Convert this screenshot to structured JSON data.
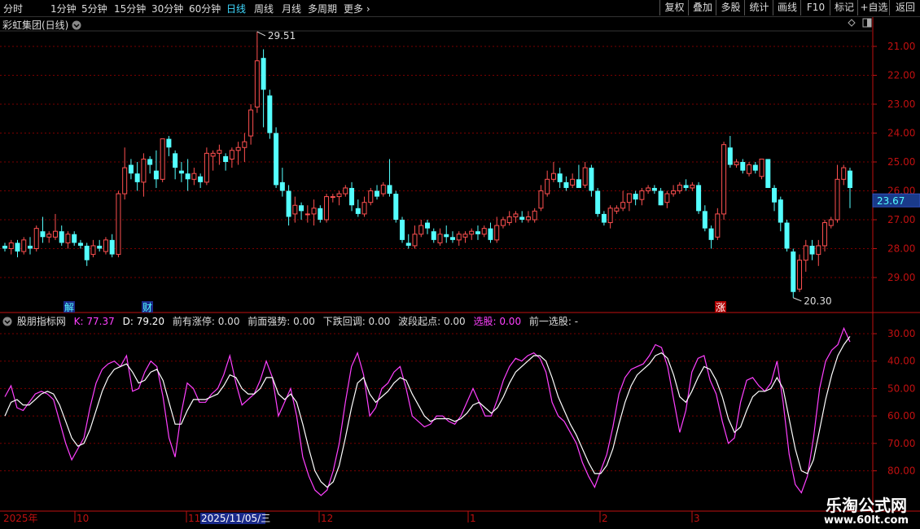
{
  "toolbar": {
    "periods": [
      "分时",
      "1分钟",
      "5分钟",
      "15分钟",
      "30分钟",
      "60分钟",
      "日线",
      "周线",
      "月线",
      "多周期",
      "更多"
    ],
    "active_period": "日线",
    "buttons": [
      "复权",
      "叠加",
      "多股",
      "统计",
      "画线",
      "F10",
      "标记",
      "+自选",
      "返回"
    ]
  },
  "stock": {
    "name": "彩虹集团(日线)"
  },
  "price_panel": {
    "y_ticks": [
      "29.00",
      "28.00",
      "27.00",
      "26.00",
      "25.00",
      "24.00",
      "23.00",
      "22.00",
      "21.00"
    ],
    "current_price": "23.67",
    "high_label": "29.51",
    "low_label": "20.30",
    "markers": [
      "解",
      "财",
      "涨"
    ]
  },
  "indicator": {
    "name": "股朋指标网",
    "k_label": "K: 77.37",
    "d_label": "D: 79.20",
    "fields": [
      "前有涨停: 0.00",
      "前面强势: 0.00",
      "下跌回调: 0.00",
      "波段起点: 0.00",
      "选股: 0.00",
      "前一选股: -"
    ],
    "y_ticks": [
      "80.00",
      "70.00",
      "60.00",
      "50.00",
      "40.00",
      "30.00"
    ]
  },
  "time_axis": [
    "2025年",
    "10",
    "11",
    "2025/11/05/三",
    "12",
    "1",
    "2",
    "3"
  ],
  "watermark": {
    "title": "乐淘公式网",
    "url": "www.60lt.com"
  },
  "colors": {
    "up": "#ff5050",
    "down": "#54ffff",
    "k_line": "#ff40ff",
    "d_line": "#ffffff",
    "grid": "#7a0000",
    "axis": "#c01010"
  },
  "chart_data": [
    {
      "type": "candlestick",
      "ylim": [
        20.0,
        30.0
      ],
      "y_ticks": [
        21,
        22,
        23,
        24,
        25,
        26,
        27,
        28,
        29
      ],
      "candles": [
        [
          22.1,
          22.2,
          21.9,
          22.0
        ],
        [
          22.0,
          22.3,
          21.8,
          22.2
        ],
        [
          22.2,
          22.3,
          21.7,
          21.9
        ],
        [
          21.9,
          22.4,
          21.8,
          22.3
        ],
        [
          22.1,
          22.4,
          21.8,
          22.0
        ],
        [
          22.0,
          22.8,
          21.9,
          22.7
        ],
        [
          22.6,
          23.1,
          22.2,
          22.4
        ],
        [
          22.4,
          22.6,
          22.2,
          22.5
        ],
        [
          22.4,
          23.2,
          22.3,
          22.6
        ],
        [
          22.6,
          22.8,
          22.1,
          22.2
        ],
        [
          22.2,
          22.6,
          22.0,
          22.5
        ],
        [
          22.5,
          22.6,
          22.1,
          22.2
        ],
        [
          22.2,
          22.3,
          22.0,
          22.1
        ],
        [
          22.1,
          22.2,
          21.4,
          21.6
        ],
        [
          21.8,
          22.3,
          21.7,
          22.1
        ],
        [
          22.1,
          22.3,
          21.9,
          22.0
        ],
        [
          21.9,
          22.4,
          21.8,
          22.3
        ],
        [
          22.3,
          22.5,
          21.7,
          21.8
        ],
        [
          21.8,
          24.0,
          21.7,
          23.9
        ],
        [
          23.9,
          25.5,
          23.7,
          24.8
        ],
        [
          24.9,
          25.1,
          24.4,
          24.6
        ],
        [
          24.6,
          25.0,
          24.0,
          24.3
        ],
        [
          24.3,
          25.3,
          23.8,
          25.1
        ],
        [
          25.1,
          25.2,
          24.6,
          24.9
        ],
        [
          24.7,
          25.4,
          24.1,
          24.4
        ],
        [
          24.4,
          25.8,
          24.3,
          25.8
        ],
        [
          25.8,
          25.9,
          25.2,
          25.5
        ],
        [
          25.3,
          25.4,
          24.4,
          24.8
        ],
        [
          24.7,
          25.0,
          24.3,
          24.6
        ],
        [
          24.6,
          25.1,
          24.0,
          24.4
        ],
        [
          24.4,
          24.8,
          24.2,
          24.6
        ],
        [
          24.5,
          24.6,
          24.1,
          24.3
        ],
        [
          24.3,
          25.5,
          24.2,
          25.3
        ],
        [
          25.2,
          25.4,
          24.7,
          25.3
        ],
        [
          25.3,
          25.6,
          24.9,
          25.4
        ],
        [
          25.2,
          25.3,
          24.7,
          25.0
        ],
        [
          25.1,
          25.5,
          24.8,
          25.4
        ],
        [
          25.4,
          25.7,
          24.9,
          25.5
        ],
        [
          25.5,
          26.0,
          25.0,
          25.7
        ],
        [
          25.9,
          27.0,
          25.6,
          26.8
        ],
        [
          26.9,
          29.51,
          26.7,
          28.5
        ],
        [
          28.6,
          28.9,
          26.2,
          27.5
        ],
        [
          27.3,
          27.5,
          25.8,
          26.0
        ],
        [
          26.0,
          26.2,
          24.1,
          24.2
        ],
        [
          24.3,
          24.8,
          23.8,
          24.0
        ],
        [
          24.0,
          24.2,
          22.8,
          23.1
        ],
        [
          23.2,
          23.8,
          22.9,
          23.5
        ],
        [
          23.5,
          23.6,
          23.0,
          23.3
        ],
        [
          23.2,
          23.5,
          22.9,
          23.2
        ],
        [
          23.2,
          23.7,
          22.8,
          23.4
        ],
        [
          23.4,
          23.5,
          22.9,
          23.0
        ],
        [
          23.0,
          23.9,
          22.9,
          23.8
        ],
        [
          23.8,
          23.9,
          23.6,
          23.8
        ],
        [
          23.8,
          24.0,
          23.5,
          23.9
        ],
        [
          23.9,
          24.2,
          23.8,
          24.1
        ],
        [
          24.1,
          24.3,
          23.3,
          23.5
        ],
        [
          23.4,
          23.7,
          23.1,
          23.2
        ],
        [
          23.2,
          23.8,
          23.1,
          23.6
        ],
        [
          23.6,
          24.1,
          23.5,
          24.0
        ],
        [
          24.0,
          24.2,
          23.7,
          23.8
        ],
        [
          23.9,
          24.3,
          23.8,
          24.2
        ],
        [
          24.2,
          25.1,
          23.8,
          23.9
        ],
        [
          23.9,
          24.0,
          22.9,
          23.0
        ],
        [
          23.0,
          23.1,
          22.2,
          22.3
        ],
        [
          22.2,
          22.5,
          22.0,
          22.1
        ],
        [
          22.1,
          22.8,
          22.0,
          22.5
        ],
        [
          22.5,
          23.0,
          22.4,
          22.8
        ],
        [
          22.9,
          23.0,
          22.5,
          22.7
        ],
        [
          22.6,
          22.7,
          22.2,
          22.3
        ],
        [
          22.2,
          22.7,
          22.1,
          22.5
        ],
        [
          22.5,
          22.8,
          22.2,
          22.4
        ],
        [
          22.4,
          22.6,
          22.2,
          22.3
        ],
        [
          22.3,
          22.6,
          22.1,
          22.5
        ],
        [
          22.4,
          22.6,
          22.2,
          22.5
        ],
        [
          22.5,
          22.7,
          22.3,
          22.6
        ],
        [
          22.6,
          22.8,
          22.3,
          22.5
        ],
        [
          22.5,
          22.8,
          22.4,
          22.7
        ],
        [
          22.7,
          22.9,
          22.2,
          22.3
        ],
        [
          22.3,
          23.1,
          22.2,
          22.8
        ],
        [
          22.8,
          23.1,
          22.7,
          23.0
        ],
        [
          22.9,
          23.3,
          22.8,
          23.1
        ],
        [
          23.1,
          23.3,
          22.9,
          23.2
        ],
        [
          23.1,
          23.3,
          22.9,
          23.0
        ],
        [
          23.0,
          23.3,
          22.9,
          23.1
        ],
        [
          23.0,
          23.4,
          22.9,
          23.3
        ],
        [
          23.4,
          24.2,
          23.3,
          24.0
        ],
        [
          23.9,
          24.7,
          23.8,
          24.4
        ],
        [
          24.4,
          25.0,
          24.3,
          24.6
        ],
        [
          24.6,
          24.8,
          24.1,
          24.3
        ],
        [
          24.3,
          24.5,
          24.0,
          24.1
        ],
        [
          24.2,
          24.6,
          24.1,
          24.4
        ],
        [
          24.4,
          24.9,
          24.2,
          24.1
        ],
        [
          24.2,
          25.0,
          24.1,
          24.8
        ],
        [
          24.8,
          24.9,
          23.8,
          24.0
        ],
        [
          24.0,
          24.1,
          23.1,
          23.2
        ],
        [
          23.2,
          23.3,
          22.8,
          22.9
        ],
        [
          22.9,
          23.5,
          22.7,
          23.4
        ],
        [
          23.3,
          23.5,
          23.2,
          23.4
        ],
        [
          23.4,
          24.0,
          23.3,
          23.6
        ],
        [
          23.6,
          23.9,
          23.3,
          23.9
        ],
        [
          23.9,
          24.0,
          23.5,
          23.7
        ],
        [
          23.7,
          24.1,
          23.5,
          24.0
        ],
        [
          24.0,
          24.2,
          23.9,
          24.1
        ],
        [
          24.1,
          24.2,
          23.9,
          24.0
        ],
        [
          24.0,
          24.1,
          23.5,
          23.5
        ],
        [
          23.6,
          24.0,
          23.4,
          23.9
        ],
        [
          23.9,
          24.2,
          23.8,
          24.0
        ],
        [
          24.0,
          24.3,
          23.9,
          24.2
        ],
        [
          24.2,
          24.4,
          24.0,
          24.1
        ],
        [
          24.1,
          24.3,
          24.0,
          24.2
        ],
        [
          24.2,
          24.3,
          23.2,
          23.3
        ],
        [
          23.3,
          23.5,
          22.6,
          22.7
        ],
        [
          22.7,
          22.8,
          22.0,
          22.3
        ],
        [
          22.4,
          23.4,
          22.3,
          23.2
        ],
        [
          23.2,
          25.7,
          23.0,
          25.6
        ],
        [
          25.5,
          25.9,
          24.8,
          24.9
        ],
        [
          24.9,
          25.1,
          24.8,
          25.0
        ],
        [
          25.0,
          25.1,
          24.6,
          24.7
        ],
        [
          24.6,
          25.0,
          24.5,
          24.9
        ],
        [
          24.9,
          25.0,
          24.6,
          24.7
        ],
        [
          24.5,
          25.1,
          24.4,
          25.1
        ],
        [
          25.1,
          25.1,
          24.1,
          24.1
        ],
        [
          24.1,
          24.2,
          23.3,
          23.6
        ],
        [
          23.7,
          23.8,
          22.6,
          22.9
        ],
        [
          22.9,
          23.0,
          21.9,
          22.0
        ],
        [
          21.9,
          22.0,
          20.3,
          20.5
        ],
        [
          20.6,
          21.8,
          20.5,
          21.6
        ],
        [
          21.6,
          22.3,
          21.2,
          22.1
        ],
        [
          22.1,
          22.3,
          21.6,
          21.8
        ],
        [
          21.8,
          22.3,
          21.4,
          22.1
        ],
        [
          22.1,
          23.0,
          21.9,
          22.9
        ],
        [
          22.8,
          23.1,
          22.7,
          23.0
        ],
        [
          23.0,
          24.9,
          22.9,
          24.4
        ],
        [
          24.4,
          24.9,
          24.2,
          24.8
        ],
        [
          24.7,
          24.8,
          23.4,
          24.1
        ]
      ]
    },
    {
      "type": "line",
      "ylim": [
        24,
        85
      ],
      "y_ticks": [
        30,
        40,
        50,
        60,
        70,
        80
      ],
      "series": [
        {
          "name": "K",
          "values": [
            57,
            61,
            53,
            52,
            55,
            58,
            59,
            58,
            56,
            48,
            40,
            34,
            38,
            42,
            53,
            62,
            67,
            69,
            70,
            68,
            72,
            59,
            60,
            66,
            70,
            68,
            57,
            42,
            35,
            51,
            62,
            60,
            55,
            55,
            58,
            60,
            65,
            72,
            62,
            54,
            56,
            58,
            63,
            70,
            64,
            50,
            55,
            60,
            50,
            35,
            28,
            23,
            21,
            23,
            30,
            40,
            55,
            68,
            73,
            65,
            50,
            53,
            60,
            62,
            66,
            68,
            60,
            50,
            48,
            46,
            47,
            50,
            50,
            48,
            47,
            50,
            55,
            60,
            55,
            50,
            50,
            56,
            63,
            68,
            71,
            70,
            72,
            73,
            71,
            66,
            55,
            50,
            48,
            44,
            40,
            33,
            28,
            24,
            30,
            36,
            46,
            58,
            64,
            67,
            68,
            69,
            72,
            76,
            75,
            68,
            56,
            44,
            52,
            66,
            71,
            72,
            63,
            58,
            48,
            40,
            42,
            55,
            63,
            64,
            61,
            59,
            62,
            70,
            55,
            36,
            25,
            22,
            28,
            42,
            60,
            70,
            74,
            76,
            82,
            77
          ]
        },
        {
          "name": "D",
          "values": [
            50,
            55,
            56,
            54,
            54,
            56,
            58,
            59,
            58,
            54,
            48,
            42,
            39,
            40,
            45,
            52,
            59,
            64,
            67,
            68,
            69,
            66,
            62,
            63,
            66,
            67,
            63,
            55,
            47,
            47,
            52,
            56,
            56,
            56,
            57,
            58,
            61,
            65,
            64,
            60,
            58,
            58,
            60,
            64,
            64,
            58,
            56,
            58,
            55,
            47,
            38,
            30,
            26,
            24,
            26,
            32,
            42,
            53,
            62,
            64,
            58,
            55,
            57,
            59,
            62,
            64,
            63,
            58,
            54,
            50,
            48,
            49,
            49,
            49,
            48,
            49,
            51,
            54,
            55,
            53,
            51,
            53,
            57,
            62,
            66,
            68,
            70,
            72,
            72,
            70,
            64,
            57,
            52,
            47,
            43,
            38,
            33,
            29,
            29,
            32,
            38,
            47,
            55,
            61,
            65,
            67,
            69,
            72,
            73,
            71,
            65,
            57,
            55,
            59,
            64,
            68,
            67,
            63,
            57,
            49,
            44,
            46,
            52,
            57,
            59,
            59,
            60,
            64,
            60,
            49,
            38,
            30,
            29,
            34,
            45,
            56,
            65,
            72,
            76,
            79
          ]
        }
      ]
    }
  ]
}
